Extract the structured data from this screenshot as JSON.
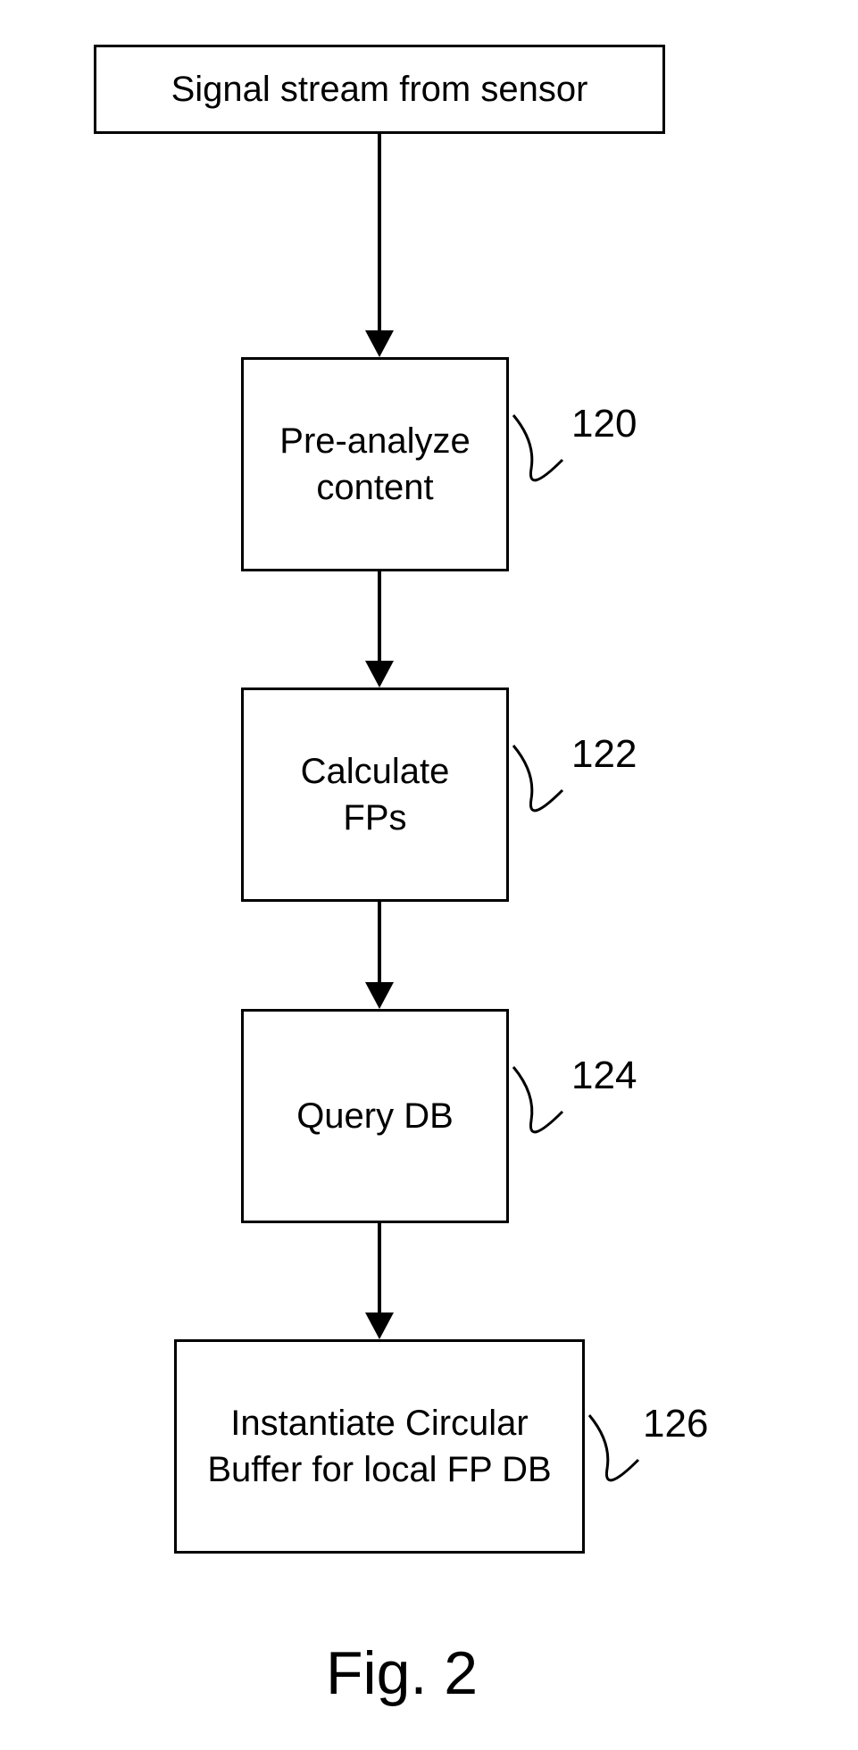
{
  "diagram": {
    "boxes": {
      "input": "Signal stream from sensor",
      "step120": "Pre-analyze\ncontent",
      "step122": "Calculate\nFPs",
      "step124": "Query DB",
      "step126": "Instantiate Circular\nBuffer for local FP DB"
    },
    "labels": {
      "ref120": "120",
      "ref122": "122",
      "ref124": "124",
      "ref126": "126"
    },
    "caption": "Fig. 2"
  }
}
